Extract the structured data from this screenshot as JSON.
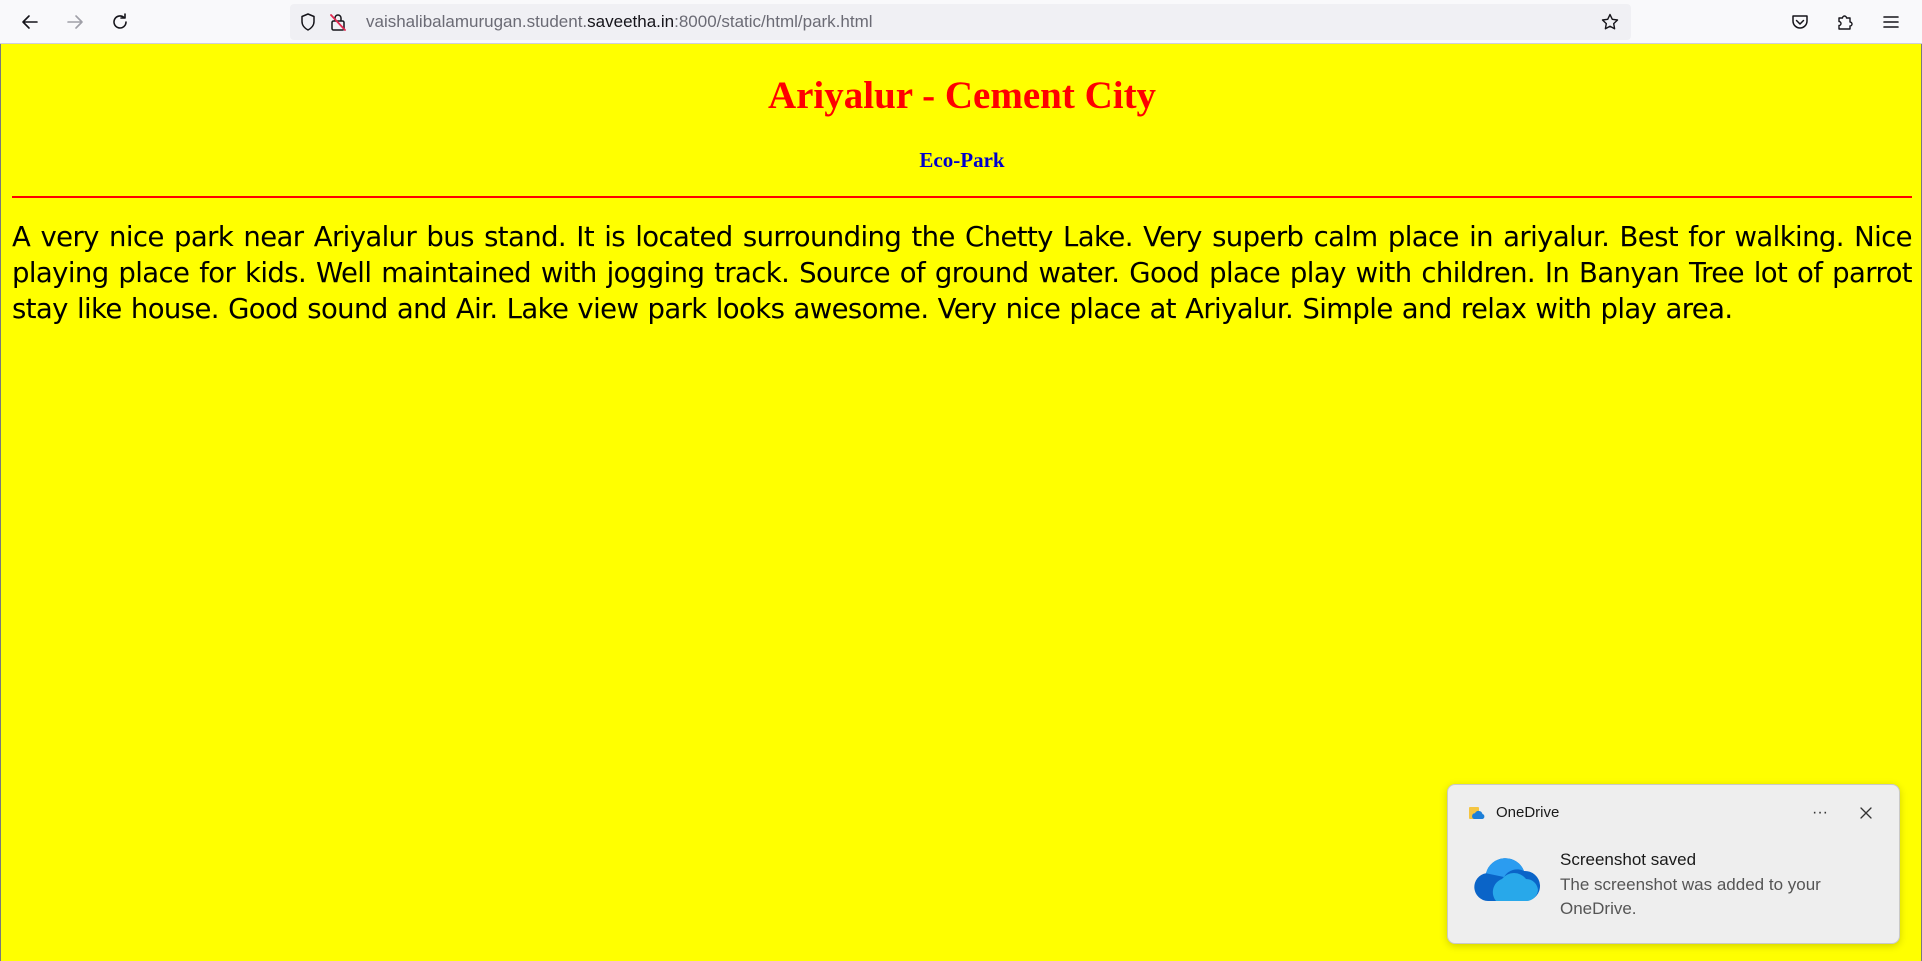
{
  "browser": {
    "url_prefix": "vaishalibalamurugan.student.",
    "url_domain": "saveetha.in",
    "url_suffix": ":8000/static/html/park.html",
    "icons": {
      "back": "back-arrow-icon",
      "forward": "forward-arrow-icon",
      "reload": "reload-icon",
      "tracking": "shield-icon",
      "insecure": "insecure-lock-icon",
      "bookmark": "star-icon",
      "pocket": "pocket-icon",
      "extensions": "puzzle-icon",
      "menu": "hamburger-menu-icon"
    }
  },
  "page": {
    "title": "Ariyalur - Cement City",
    "subtitle": "Eco-Park",
    "paragraph": "A very nice park near Ariyalur bus stand. It is located surrounding the Chetty Lake. Very superb calm place in ariyalur. Best for walking. Nice playing place for kids. Well maintained with jogging track. Source of ground water. Good place play with children. In Banyan Tree lot of parrot stay like house. Good sound and Air. Lake view park looks awesome. Very nice place at Ariyalur. Simple and relax with play area.",
    "colors": {
      "background": "#ffff00",
      "title": "#ff0000",
      "subtitle": "#0000cc",
      "rule": "#ff0000"
    }
  },
  "toast": {
    "app_name": "OneDrive",
    "more": "···",
    "title": "Screenshot saved",
    "body": "The screenshot was added to your OneDrive."
  }
}
